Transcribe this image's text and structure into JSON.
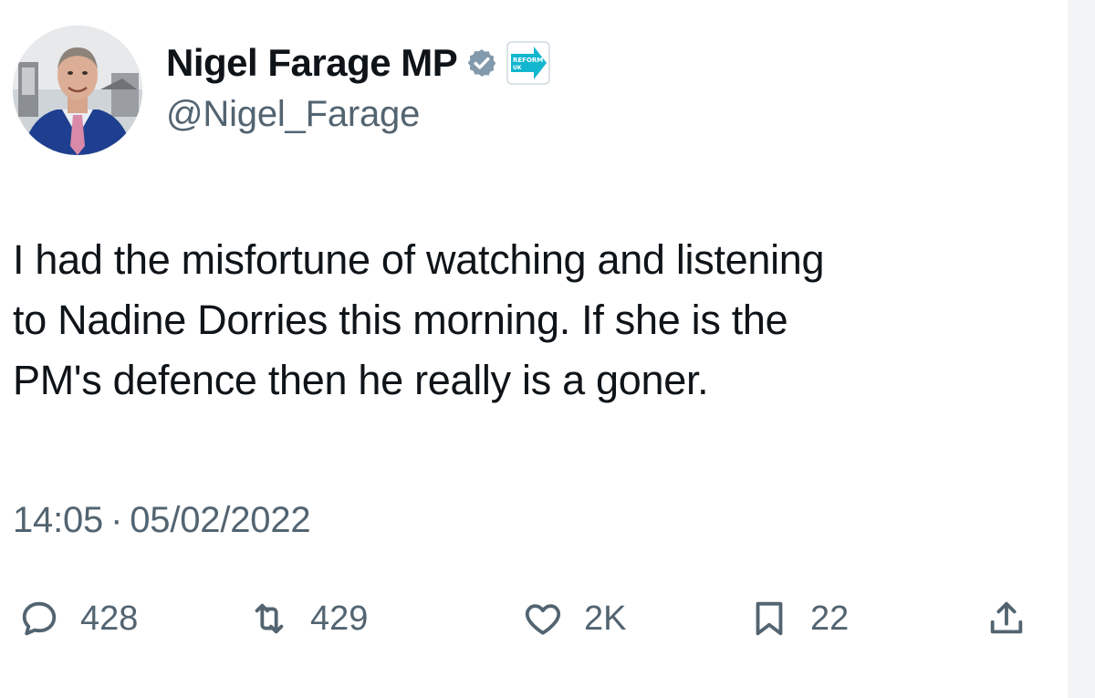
{
  "author": {
    "display_name": "Nigel Farage MP",
    "handle": "@Nigel_Farage",
    "verified_icon": "verified-badge-icon",
    "affiliate_badge_text": "REFORM UK",
    "affiliate_badge_color": "#12b6cf",
    "verified_color": "#829aab"
  },
  "tweet": {
    "text_lines": [
      "I had the misfortune of watching and listening",
      "to Nadine Dorries this morning. If she is the",
      "PM's defence then he really is a goner."
    ],
    "time": "14:05",
    "separator": "·",
    "date": "05/02/2022"
  },
  "actions": {
    "reply": {
      "icon": "reply-icon",
      "count": "428"
    },
    "retweet": {
      "icon": "retweet-icon",
      "count": "429"
    },
    "like": {
      "icon": "heart-icon",
      "count": "2K"
    },
    "bookmark": {
      "icon": "bookmark-icon",
      "count": "22"
    },
    "share": {
      "icon": "share-icon"
    }
  }
}
